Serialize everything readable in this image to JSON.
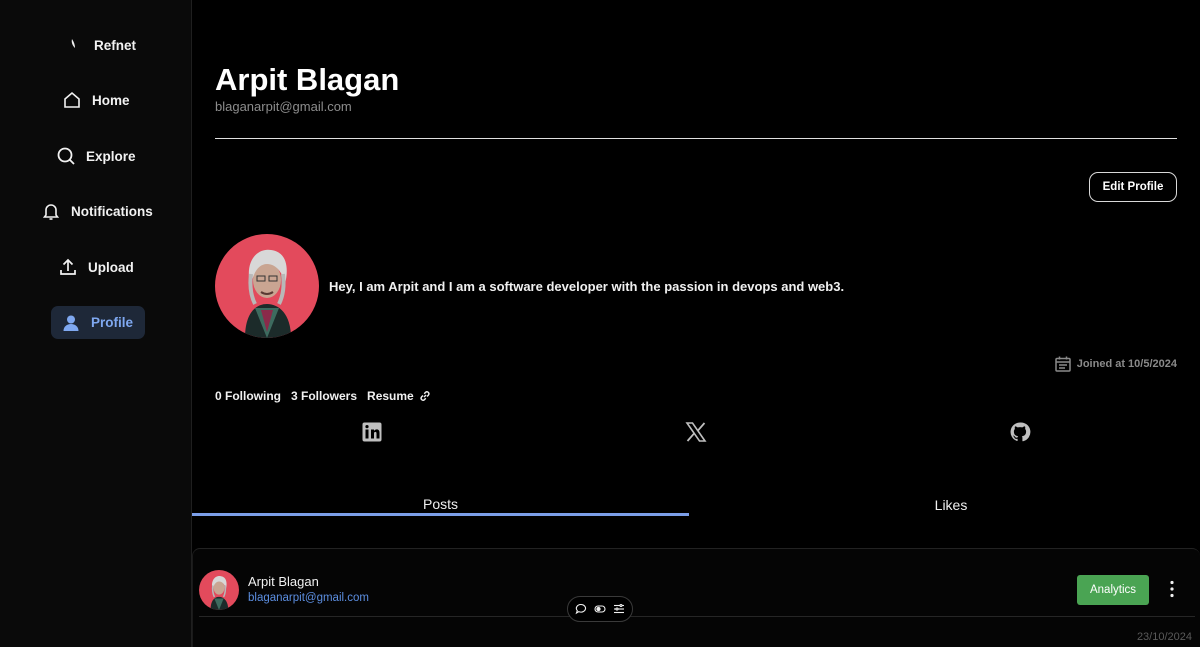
{
  "sidebar": {
    "brand": "Refnet",
    "items": [
      {
        "label": "Home",
        "icon": "home-icon"
      },
      {
        "label": "Explore",
        "icon": "search-icon"
      },
      {
        "label": "Notifications",
        "icon": "bell-icon"
      },
      {
        "label": "Upload",
        "icon": "upload-icon"
      },
      {
        "label": "Profile",
        "icon": "user-icon",
        "active": true
      }
    ]
  },
  "profile": {
    "name": "Arpit Blagan",
    "email": "blaganarpit@gmail.com",
    "edit_label": "Edit Profile",
    "bio": "Hey, I am Arpit and I am a software developer with the passion in devops and web3.",
    "joined": "Joined at 10/5/2024",
    "following": "0 Following",
    "followers": "3 Followers",
    "resume": "Resume",
    "social": [
      "linkedin-icon",
      "x-icon",
      "github-icon"
    ]
  },
  "tabs": [
    {
      "label": "Posts",
      "active": true
    },
    {
      "label": "Likes",
      "active": false
    }
  ],
  "post": {
    "author": "Arpit Blagan",
    "email": "blaganarpit@gmail.com",
    "analytics_label": "Analytics",
    "date": "23/10/2024"
  },
  "colors": {
    "accent": "#7b9ee8",
    "active_nav_bg": "#1e2838",
    "analytics_green": "#4aa453",
    "link_blue": "#5c8ee0"
  }
}
